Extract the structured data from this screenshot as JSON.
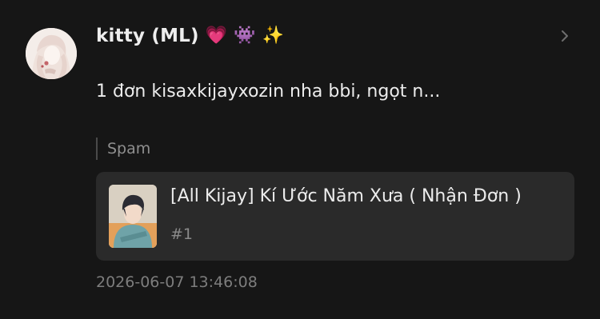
{
  "post": {
    "username": "kitty (ML)",
    "emojis": [
      "💗",
      "👾",
      "✨"
    ],
    "message": "1 đơn kisaxkijayxozin nha bbi, ngọt n...",
    "tag": "Spam",
    "story": {
      "title": "[All Kijay] Kí Ước Năm Xưa ( Nhận Đơn )",
      "chapter": "#1"
    },
    "timestamp": "2026-06-07 13:46:08"
  },
  "icons": {
    "avatar": "user-avatar",
    "chevron": "chevron-right-icon",
    "cover": "story-cover"
  },
  "colors": {
    "background": "#161616",
    "card": "#2a2a2a",
    "text": "#ececec",
    "muted": "#8a8a8a"
  }
}
